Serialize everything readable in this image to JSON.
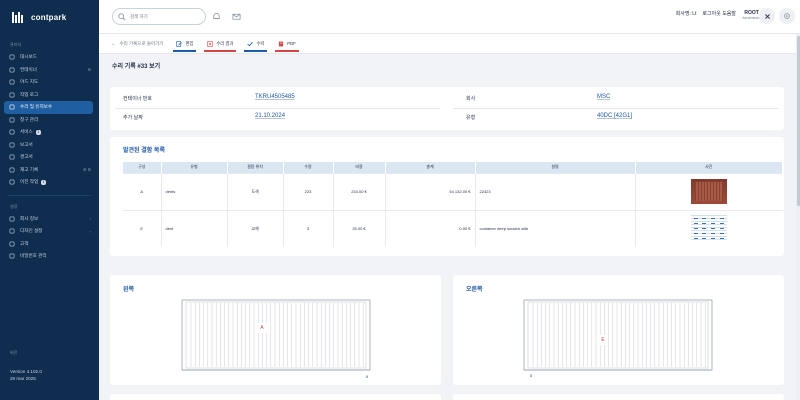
{
  "app": {
    "name": "contpark"
  },
  "sidebar": {
    "section1": "관리자",
    "items": [
      {
        "label": "대시보드",
        "icon": "home-icon"
      },
      {
        "label": "컨테이너",
        "icon": "container-icon",
        "tail": "⊞"
      },
      {
        "label": "야드 지도",
        "icon": "map-icon"
      },
      {
        "label": "작업 로그",
        "icon": "list-icon"
      },
      {
        "label": "수리 및 유지보수",
        "icon": "wrench-icon",
        "active": true
      },
      {
        "label": "청구 관리",
        "icon": "billing-icon"
      },
      {
        "label": "서비스",
        "icon": "service-icon",
        "pill": "1"
      },
      {
        "label": "보고서",
        "icon": "report-icon"
      },
      {
        "label": "경고서",
        "icon": "warning-icon"
      },
      {
        "label": "재고 기록",
        "icon": "stock-icon",
        "tail": "⊞ ⊞"
      },
      {
        "label": "이전 작업",
        "icon": "history-icon",
        "pill": "1"
      }
    ],
    "section2": "설정",
    "items2": [
      {
        "label": "회사 정보",
        "icon": "company-icon",
        "tail": "›"
      },
      {
        "label": "디자인 설정",
        "icon": "design-icon",
        "tail": "›"
      },
      {
        "label": "고객",
        "icon": "customer-icon"
      },
      {
        "label": "비밀번호 관리",
        "icon": "key-icon"
      }
    ],
    "version_header": "버전",
    "version": "Version 4.102.0",
    "version_date": "28 mar 2025"
  },
  "topbar": {
    "search_placeholder": "검색 하기",
    "user_label": "회사명: Lt",
    "user_label2": "로그아웃 도움말",
    "root": "ROOT",
    "root_sub": "Administrator"
  },
  "toolbar": {
    "back": "수리 기록으로 돌아가기",
    "buttons": [
      {
        "label": "편집",
        "color": "#1e5aa8"
      },
      {
        "label": "수리 결과",
        "color": "#d64545"
      },
      {
        "label": "수락",
        "color": "#1e5aa8"
      },
      {
        "label": "PDF",
        "color": "#d64545"
      }
    ]
  },
  "page": {
    "title": "수리 기록 #33 보기"
  },
  "info": {
    "container_no_label": "컨테이너 번호",
    "container_no": "TKRU4505485",
    "added_date_label": "추가 날짜",
    "added_date": "21.10.2024",
    "company_label": "회사",
    "company": "MSC",
    "type_label": "유형",
    "type": "40DC [42G1]"
  },
  "damage": {
    "title": "발견된 결함 목록",
    "headers": [
      "구성",
      "유형",
      "결함 위치",
      "수량",
      "비용",
      "총계",
      "설명",
      "사진"
    ],
    "rows": [
      {
        "section": "A",
        "type": "dents",
        "location": "도색",
        "qty": "223",
        "cost": "234.00 €",
        "total": "54 132.00 €",
        "desc": "22423"
      },
      {
        "section": "E",
        "type": "dent",
        "location": "교체",
        "qty": "3",
        "cost": "25.00 €",
        "total": "0.00 €",
        "desc": "container deep scratch with"
      }
    ]
  },
  "views": {
    "left_title": "왼쪽",
    "left_marker": "A",
    "left_mark": "8",
    "right_title": "오른쪽",
    "right_marker": "E",
    "right_mark": "8"
  }
}
